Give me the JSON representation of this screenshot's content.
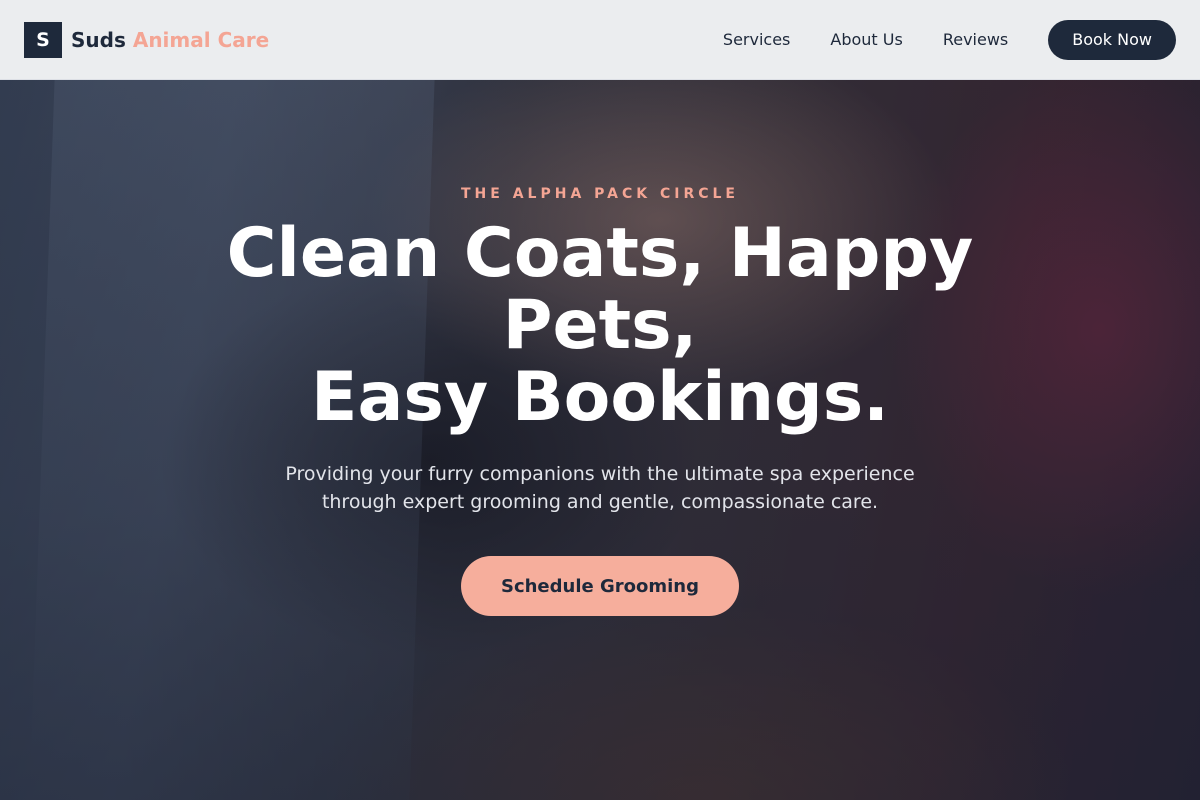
{
  "brand": {
    "mark": "S",
    "name_primary": "Suds",
    "name_accent": "Animal Care"
  },
  "nav": {
    "links": [
      "Services",
      "About Us",
      "Reviews"
    ],
    "cta_label": "Book Now"
  },
  "hero": {
    "eyebrow": "THE ALPHA PACK CIRCLE",
    "headline_lines": [
      "Clean Coats, Happy",
      "Pets,",
      "Easy Bookings."
    ],
    "subtext_lines": [
      "Providing your furry companions with the ultimate spa experience",
      "through expert grooming and gentle, compassionate care."
    ],
    "cta_label": "Schedule Grooming"
  },
  "colors": {
    "brand_dark": "#1e293b",
    "accent_peach": "#f4a594",
    "header_bg": "#f3f4f6"
  }
}
